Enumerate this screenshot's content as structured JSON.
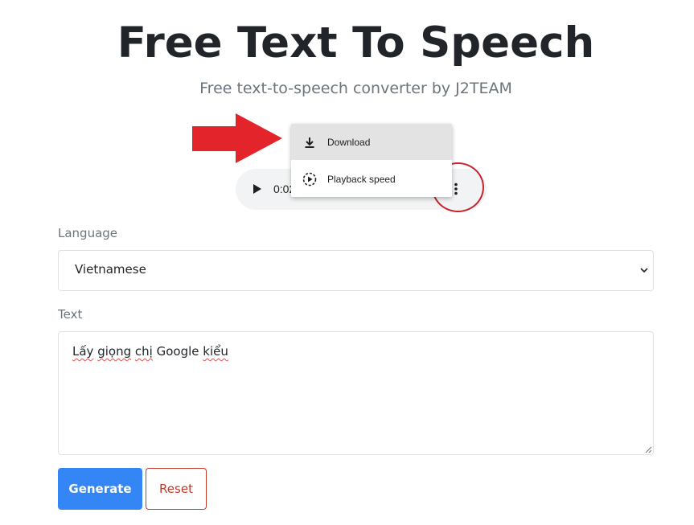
{
  "header": {
    "title": "Free Text To Speech",
    "subtitle": "Free text-to-speech converter by J2TEAM"
  },
  "audio_player": {
    "time": "0:02",
    "menu": {
      "items": [
        {
          "label": "Download",
          "icon": "download-icon"
        },
        {
          "label": "Playback speed",
          "icon": "playback-speed-icon"
        }
      ]
    }
  },
  "form": {
    "language_label": "Language",
    "language_value": "Vietnamese",
    "text_label": "Text",
    "text_words": [
      "Lấy",
      "giọng",
      "chị",
      "Google",
      "kiểu"
    ],
    "generate_label": "Generate",
    "reset_label": "Reset"
  },
  "colors": {
    "primary": "#3486f6",
    "danger": "#c0392b",
    "annotation": "#e3242b"
  }
}
